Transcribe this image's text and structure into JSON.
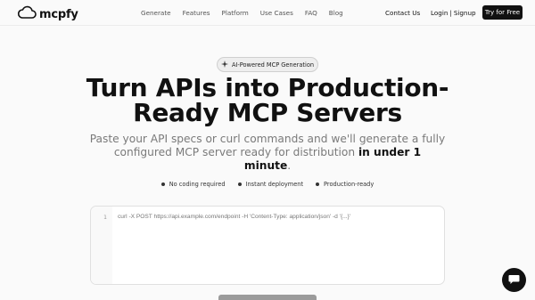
{
  "header": {
    "logo_text": "mcpfy",
    "nav": [
      "Generate",
      "Features",
      "Platform",
      "Use Cases",
      "FAQ",
      "Blog"
    ],
    "contact_label": "Contact Us",
    "login_label": "Login",
    "login_separator": "|",
    "signup_label": "Signup",
    "cta_label": "Try for Free"
  },
  "hero": {
    "badge": "AI-Powered MCP Generation",
    "title_line1": "Turn APIs into Production-",
    "title_line2": "Ready MCP Servers",
    "subtitle_pre": "Paste your API specs or curl commands and we'll generate a fully configured MCP server ready for distribution ",
    "subtitle_bold": "in under 1 minute",
    "subtitle_post": "."
  },
  "features": [
    "No coding required",
    "Instant deployment",
    "Production-ready"
  ],
  "editor": {
    "line_number": "1",
    "placeholder": "curl -X POST https://api.example.com/endpoint -H 'Content-Type: application/json' -d '{...}'"
  },
  "icons": {
    "logo": "cloud-icon",
    "badge": "sparkle-icon",
    "chat": "chat-bubble-icon"
  },
  "colors": {
    "primary": "#111111",
    "background": "#fafafa",
    "muted_text": "#7a7a7a",
    "submit_disabled": "#9b9b9b"
  }
}
